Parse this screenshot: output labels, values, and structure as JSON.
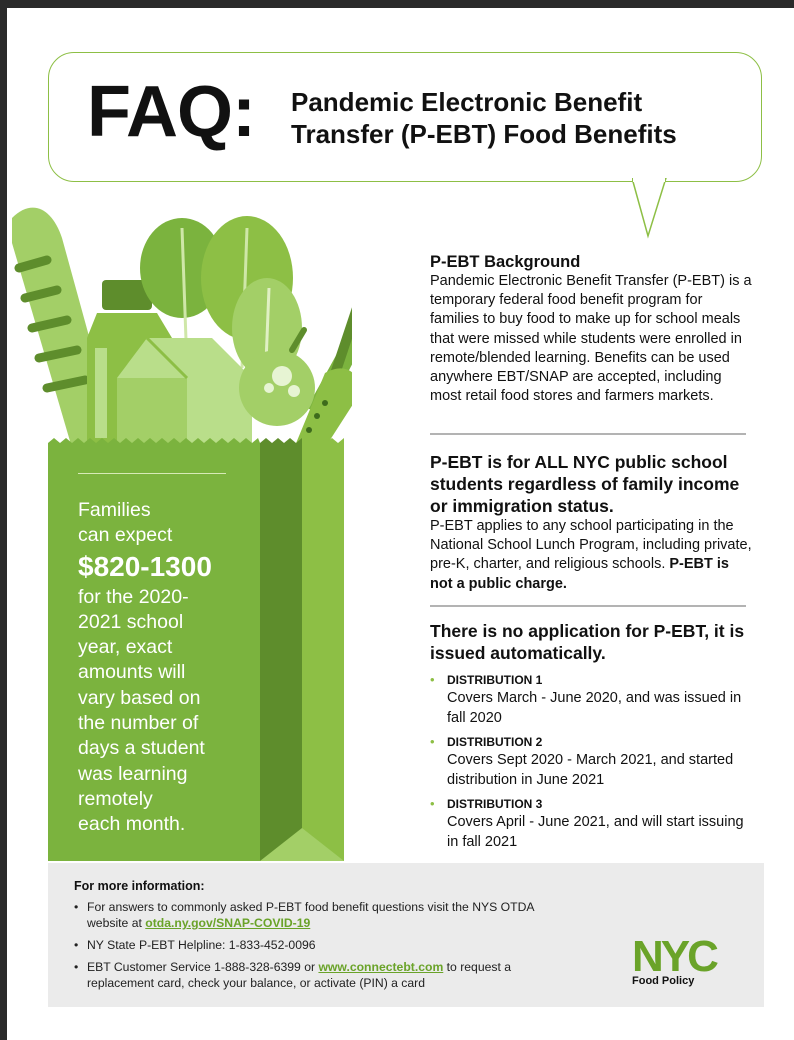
{
  "header": {
    "faq": "FAQ:",
    "subtitle_line1": "Pandemic Electronic Benefit",
    "subtitle_line2": "Transfer (P-EBT) Food Benefits"
  },
  "bag": {
    "line1": "Families",
    "line2": "can expect",
    "amount": "$820-1300",
    "line3": "for the 2020-",
    "line4": "2021 school",
    "line5": "year, exact",
    "line6": "amounts will",
    "line7": "vary based on",
    "line8": "the number of",
    "line9": "days a student",
    "line10": "was learning",
    "line11": "remotely",
    "line12": "each month."
  },
  "background": {
    "title": "P-EBT Background",
    "body": "Pandemic Electronic Benefit Transfer (P-EBT) is a temporary federal food benefit program for families to buy food to make up for school meals that were missed while students were enrolled in remote/blended learning. Benefits can be used anywhere EBT/SNAP are accepted, including most retail food stores and farmers markets."
  },
  "eligibility": {
    "title": "P-EBT is for ALL NYC public school students regardless of family income or immigration status.",
    "body": "P-EBT applies to any school participating in the National School Lunch Program, including private, pre-K, charter, and religious schools.",
    "bold_note": "P-EBT is not a public charge."
  },
  "application": {
    "title": "There is no application for P-EBT, it is issued automatically.",
    "distributions": [
      {
        "label": "DISTRIBUTION 1",
        "text": "Covers March - June 2020, and was issued in fall 2020"
      },
      {
        "label": "DISTRIBUTION 2",
        "text": "Covers Sept 2020 - March 2021, and started distribution in June 2021"
      },
      {
        "label": "DISTRIBUTION 3",
        "text": "Covers April - June 2021, and will start issuing in fall 2021"
      }
    ]
  },
  "footer": {
    "title": "For more information:",
    "item1_text": "For answers to commonly asked P-EBT food benefit questions visit the NYS OTDA website at ",
    "item1_link": "otda.ny.gov/SNAP-COVID-19",
    "item2_text": "NY State P-EBT Helpline: 1-833-452-0096",
    "item3_pre": "EBT Customer Service 1-888-328-6399 or ",
    "item3_link": "www.connectebt.com",
    "item3_post": " to request a replacement card, check your balance, or activate (PIN) a card",
    "bullet": "•",
    "logo_text": "NYC",
    "logo_sub": "Food Policy"
  },
  "colors": {
    "green": "#8dbf45",
    "dark_green": "#5e8d2c",
    "bag_green": "#7bb33e",
    "footer_bg": "#ebebeb",
    "link_green": "#6aa329"
  }
}
